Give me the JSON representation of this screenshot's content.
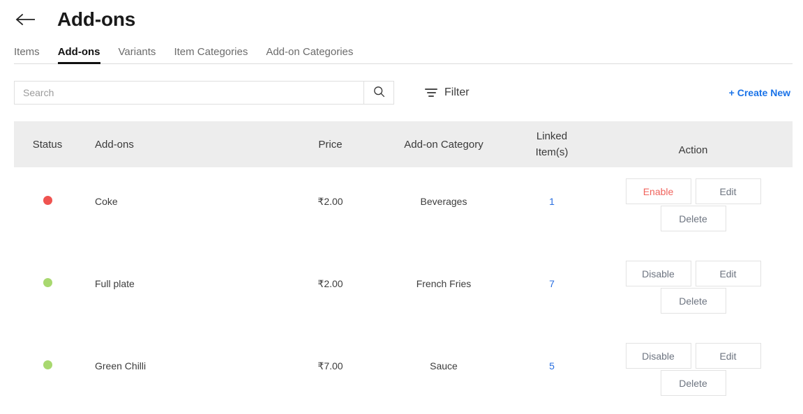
{
  "header": {
    "back_icon": "arrow-left-icon",
    "title": "Add-ons"
  },
  "tabs": [
    {
      "label": "Items",
      "active": false
    },
    {
      "label": "Add-ons",
      "active": true
    },
    {
      "label": "Variants",
      "active": false
    },
    {
      "label": "Item Categories",
      "active": false
    },
    {
      "label": "Add-on Categories",
      "active": false
    }
  ],
  "toolbar": {
    "search_placeholder": "Search",
    "search_value": "",
    "search_icon": "search-icon",
    "filter_label": "Filter",
    "filter_icon": "filter-icon",
    "create_new_label": "+ Create New",
    "link_color": "#1a73e8"
  },
  "table": {
    "columns": {
      "status": "Status",
      "name": "Add-ons",
      "price": "Price",
      "category": "Add-on Category",
      "linked_line1": "Linked",
      "linked_line2": "Item(s)",
      "action": "Action"
    },
    "rows": [
      {
        "status": "inactive",
        "status_color": "#ef5350",
        "name": "Coke",
        "price": "₹2.00",
        "category": "Beverages",
        "linked": "1",
        "toggle_label": "Enable",
        "toggle_kind": "danger",
        "edit_label": "Edit",
        "delete_label": "Delete"
      },
      {
        "status": "active",
        "status_color": "#a8d86f",
        "name": "Full plate",
        "price": "₹2.00",
        "category": "French Fries",
        "linked": "7",
        "toggle_label": "Disable",
        "toggle_kind": "normal",
        "edit_label": "Edit",
        "delete_label": "Delete"
      },
      {
        "status": "active",
        "status_color": "#a8d86f",
        "name": "Green Chilli",
        "price": "₹7.00",
        "category": "Sauce",
        "linked": "5",
        "toggle_label": "Disable",
        "toggle_kind": "normal",
        "edit_label": "Edit",
        "delete_label": "Delete"
      }
    ]
  }
}
